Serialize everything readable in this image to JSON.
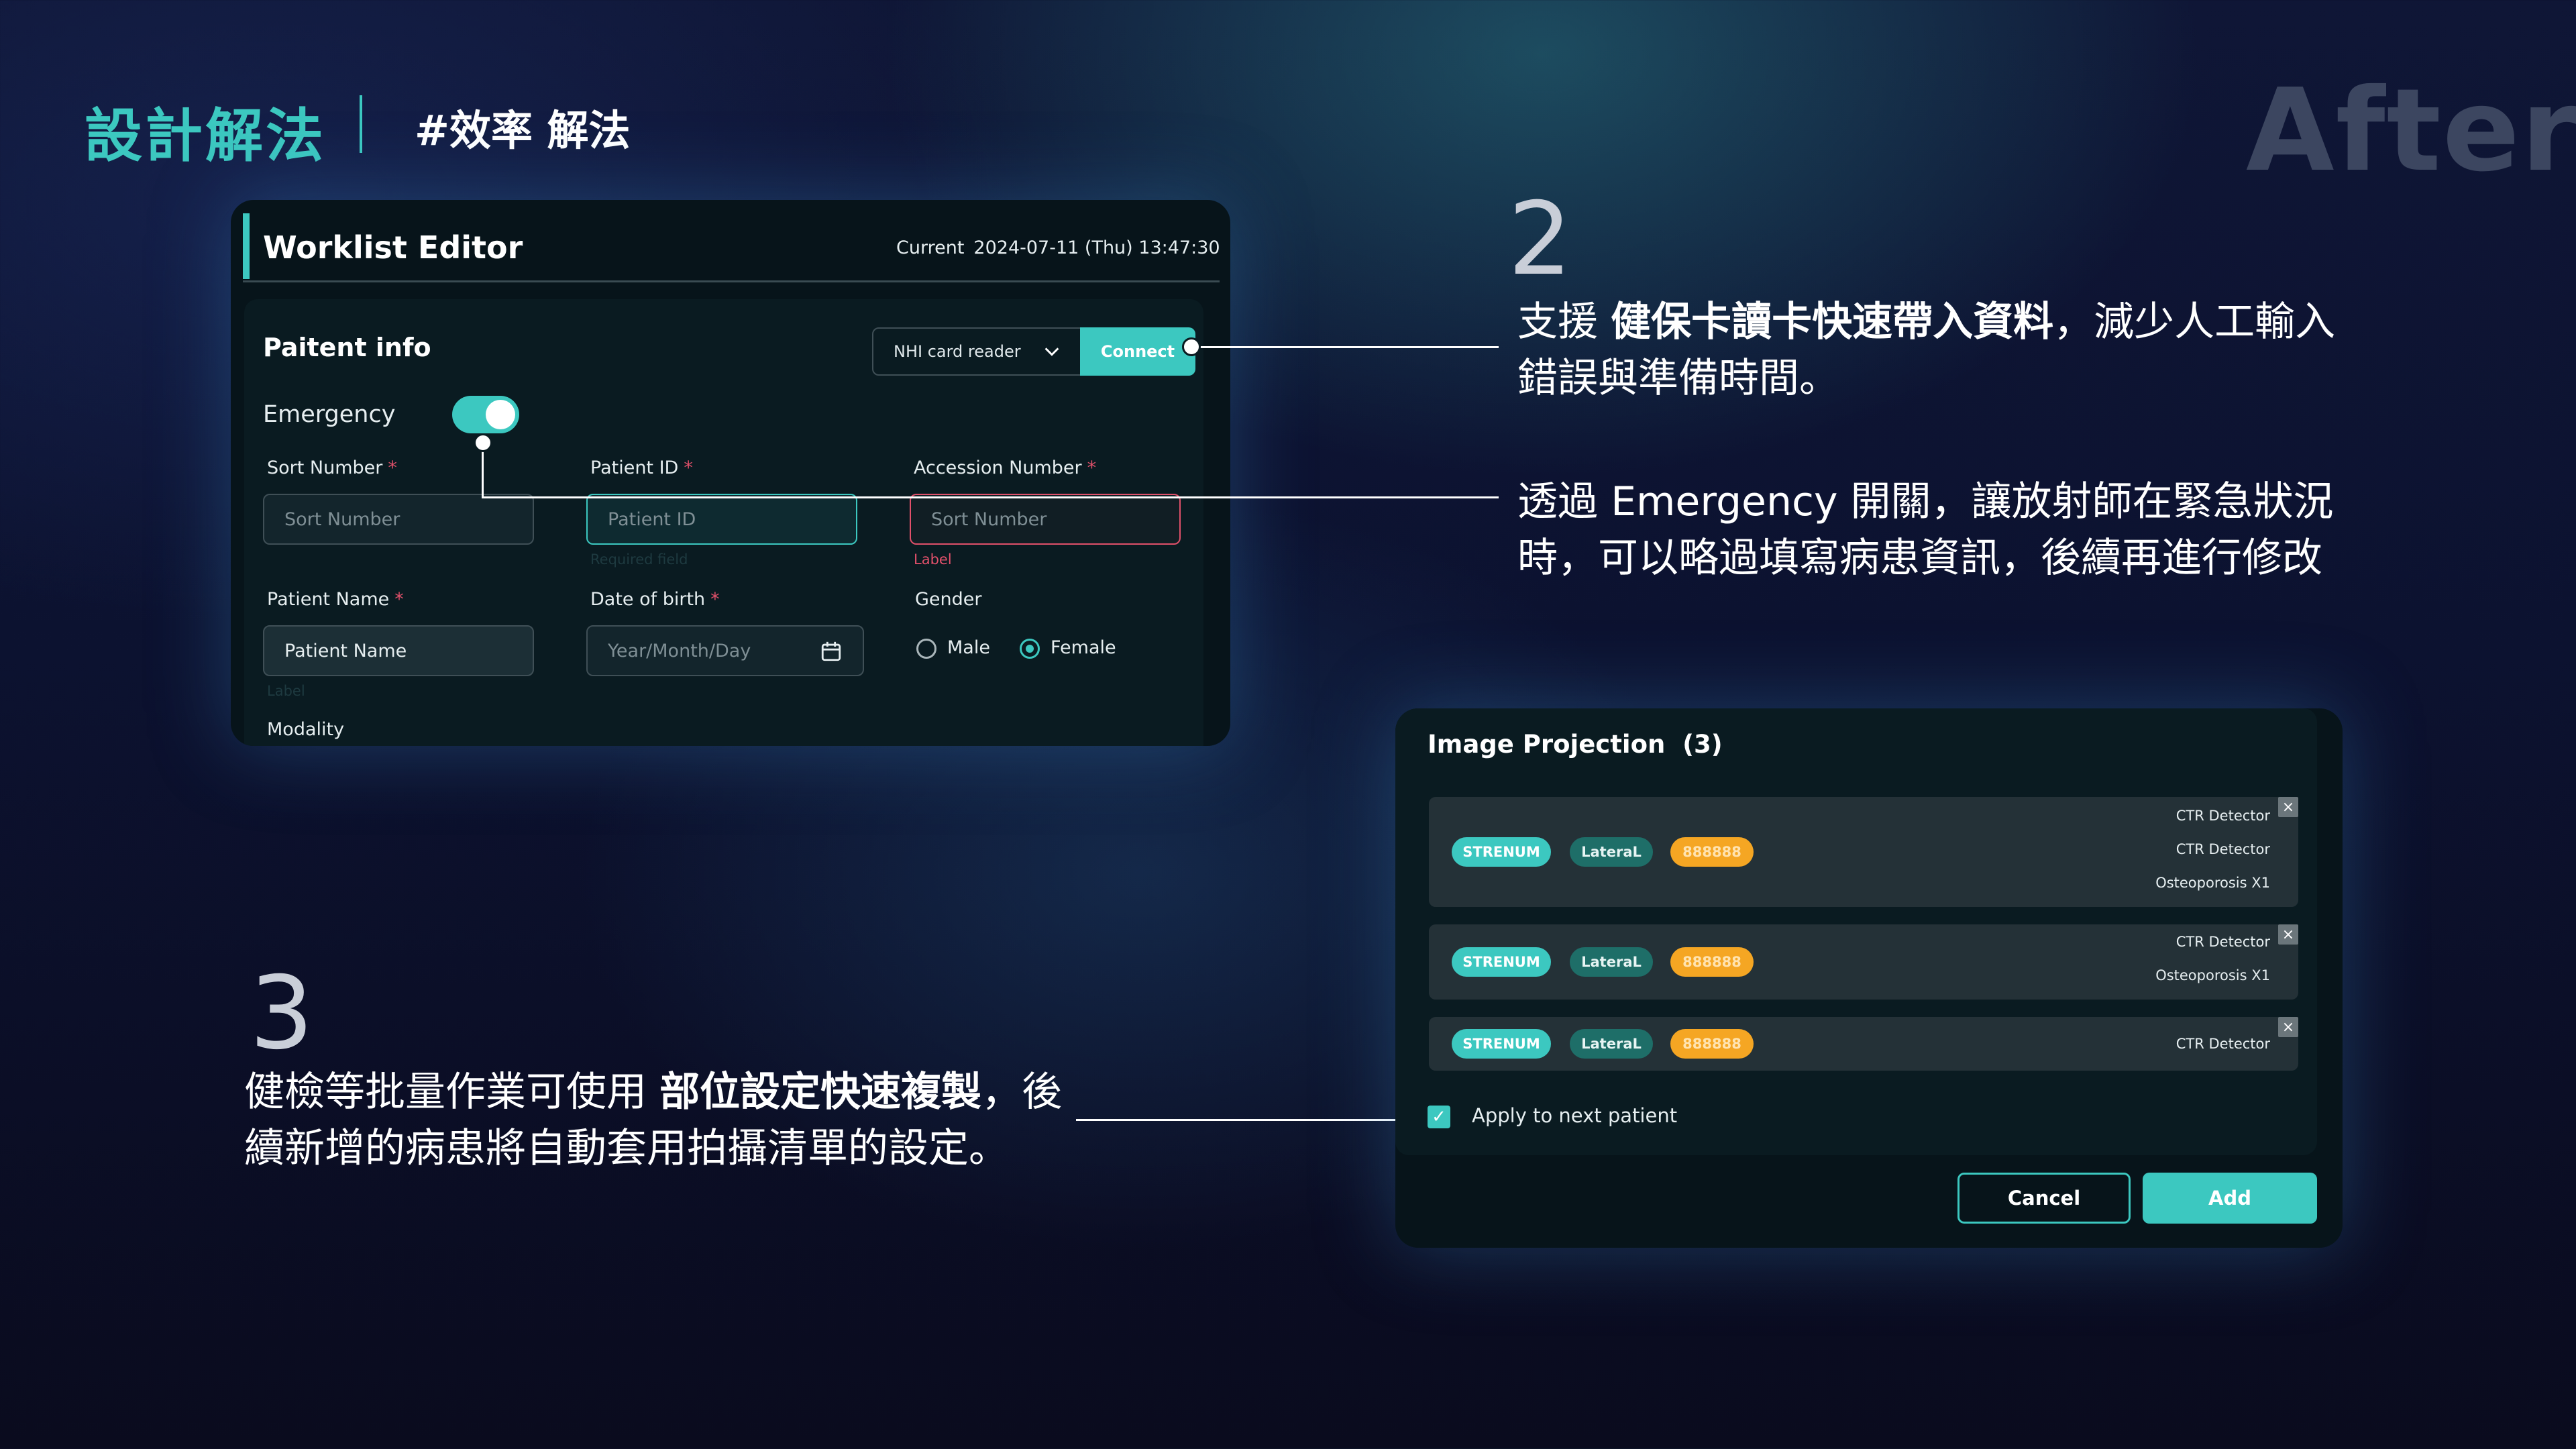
{
  "header": {
    "title": "設計解法",
    "tag": "#效率 解法",
    "after": "After"
  },
  "worklist": {
    "title": "Worklist Editor",
    "current_label": "Current",
    "current_datetime": "2024-07-11 (Thu) 13:47:30",
    "section_title": "Paitent info",
    "card_reader": {
      "selected": "NHI card reader",
      "connect_label": "Connect"
    },
    "emergency": {
      "label": "Emergency",
      "on": true
    },
    "required_mark": "*",
    "fields": {
      "sort_number": {
        "label": "Sort Number",
        "placeholder": "Sort Number"
      },
      "patient_id": {
        "label": "Patient ID",
        "placeholder": "Patient ID",
        "helper": "Required field"
      },
      "accession_number": {
        "label": "Accession Number",
        "placeholder": "Sort Number",
        "helper": "Label"
      },
      "patient_name": {
        "label": "Patient Name",
        "value": "Patient Name",
        "helper": "Label"
      },
      "date_of_birth": {
        "label": "Date of birth",
        "placeholder": "Year/Month/Day"
      },
      "gender": {
        "label": "Gender",
        "options": [
          "Male",
          "Female"
        ],
        "selected": "Female"
      },
      "modality": {
        "label": "Modality"
      }
    }
  },
  "annotations": {
    "a2": {
      "number": "2",
      "line1_pre": "支援 ",
      "line1_bold": "健保卡讀卡快速帶入資料",
      "line1_post": "，減少人工輸入",
      "line2": "錯誤與準備時間。"
    },
    "a_emergency": {
      "line1": "透過 Emergency 開關，讓放射師在緊急狀況",
      "line2": "時，可以略過填寫病患資訊，後續再進行修改"
    },
    "a3": {
      "number": "3",
      "line1_pre": "健檢等批量作業可使用 ",
      "line1_bold": "部位設定快速複製",
      "line1_post": "，後",
      "line2": "續新增的病患將自動套用拍攝清單的設定。"
    }
  },
  "projection": {
    "title": "Image Projection",
    "count": "(3)",
    "rows": [
      {
        "chips": [
          "STRENUM",
          "LateraL",
          "888888"
        ],
        "detectors": [
          "CTR Detector",
          "CTR Detector",
          "Osteoporosis X1"
        ]
      },
      {
        "chips": [
          "STRENUM",
          "LateraL",
          "888888"
        ],
        "detectors": [
          "CTR Detector",
          "Osteoporosis X1"
        ]
      },
      {
        "chips": [
          "STRENUM",
          "LateraL",
          "888888"
        ],
        "detectors": [
          "CTR Detector"
        ]
      }
    ],
    "remove_symbol": "×",
    "apply_label": "Apply to next patient",
    "apply_checked": true,
    "cancel_label": "Cancel",
    "add_label": "Add"
  },
  "colors": {
    "accent": "#3cc8c0",
    "error": "#e0506a",
    "warning_chip": "#f5a623",
    "card_bg": "#07141a",
    "after_text": "#3c4660"
  }
}
